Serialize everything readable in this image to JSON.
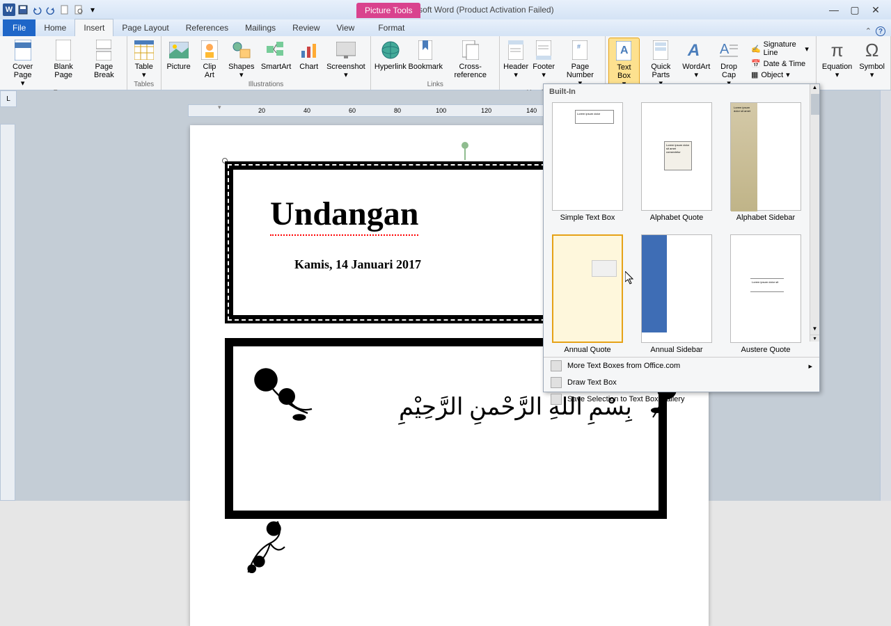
{
  "title": "527_B - Microsoft Word (Product Activation Failed)",
  "contextual_tab": "Picture Tools",
  "tabs": {
    "file": "File",
    "home": "Home",
    "insert": "Insert",
    "page_layout": "Page Layout",
    "references": "References",
    "mailings": "Mailings",
    "review": "Review",
    "view": "View",
    "format": "Format"
  },
  "ribbon": {
    "pages": {
      "cover": "Cover Page",
      "blank": "Blank Page",
      "break": "Page Break",
      "label": "Pages"
    },
    "tables": {
      "table": "Table",
      "label": "Tables"
    },
    "illustrations": {
      "picture": "Picture",
      "clipart": "Clip Art",
      "shapes": "Shapes",
      "smartart": "SmartArt",
      "chart": "Chart",
      "screenshot": "Screenshot",
      "label": "Illustrations"
    },
    "links": {
      "hyperlink": "Hyperlink",
      "bookmark": "Bookmark",
      "crossref": "Cross-reference",
      "label": "Links"
    },
    "headerfooter": {
      "header": "Header",
      "footer": "Footer",
      "pagenum": "Page Number",
      "label": "Header & Footer"
    },
    "text": {
      "textbox": "Text Box",
      "quickparts": "Quick Parts",
      "wordart": "WordArt",
      "dropcap": "Drop Cap",
      "sig": "Signature Line",
      "datetime": "Date & Time",
      "object": "Object"
    },
    "symbols": {
      "equation": "Equation",
      "symbol": "Symbol"
    }
  },
  "gallery": {
    "header": "Built-In",
    "items": [
      {
        "label": "Simple Text Box"
      },
      {
        "label": "Alphabet Quote"
      },
      {
        "label": "Alphabet Sidebar"
      },
      {
        "label": "Annual Quote"
      },
      {
        "label": "Annual Sidebar"
      },
      {
        "label": "Austere Quote"
      }
    ],
    "more": "More Text Boxes from Office.com",
    "draw": "Draw Text Box",
    "save": "Save Selection to Text Box Gallery"
  },
  "document": {
    "title": "Undangan",
    "date": "Kamis, 14 Januari 2017",
    "arabic": "بِسْمِ اللهِ الرَّحْمنِ الرَّحِيْمِ"
  },
  "ruler_marks": [
    "20",
    "40",
    "60",
    "80",
    "100",
    "120",
    "140"
  ]
}
